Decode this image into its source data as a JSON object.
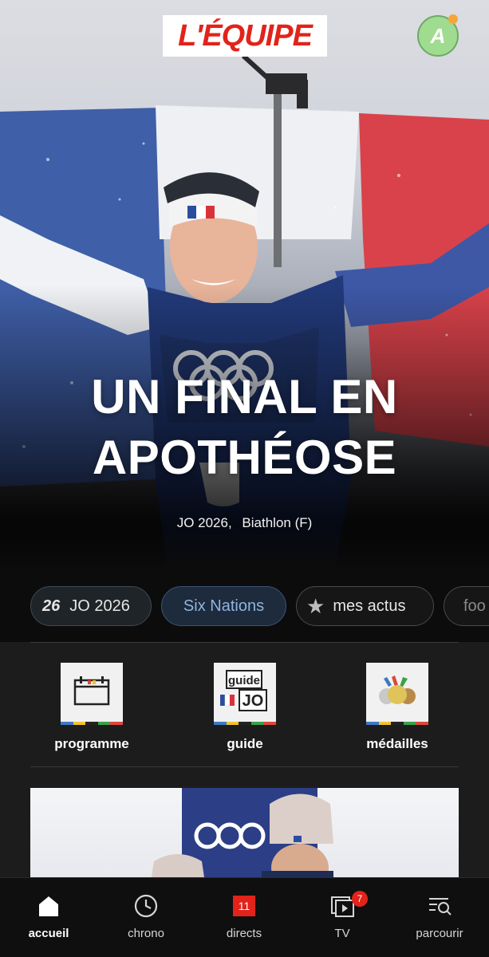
{
  "header": {
    "logo_text": "L'ÉQUIPE",
    "avatar_initial": "A"
  },
  "hero": {
    "headline_line1": "UN FINAL EN",
    "headline_line2": "APOTHÉOSE",
    "tags": [
      "JO 2026,",
      "Biathlon (F)"
    ]
  },
  "chips": [
    {
      "label": "JO 2026",
      "icon": "jo-2026-icon"
    },
    {
      "label": "Six Nations",
      "selected": true
    },
    {
      "label": "mes actus",
      "icon": "star-icon"
    },
    {
      "label": "foo"
    }
  ],
  "quick_links": [
    {
      "label": "programme",
      "icon": "calendar-icon"
    },
    {
      "label": "guide",
      "icon": "guide-jo-icon",
      "icon_text_top": "guide",
      "icon_text_bottom": "JO"
    },
    {
      "label": "médailles",
      "icon": "medals-icon"
    }
  ],
  "bottom_nav": [
    {
      "label": "accueil",
      "icon": "home-icon",
      "active": true
    },
    {
      "label": "chrono",
      "icon": "clock-icon"
    },
    {
      "label": "directs",
      "icon": "live-icon",
      "badge": "11"
    },
    {
      "label": "TV",
      "icon": "tv-icon",
      "badge": "7"
    },
    {
      "label": "parcourir",
      "icon": "browse-icon"
    }
  ],
  "colors": {
    "brand_red": "#e2231a",
    "background": "#1c1c1c",
    "chip_selected_bg": "#1d2b3c",
    "chip_selected_text": "#8fb4df",
    "avatar_green": "#9fdc8f",
    "avatar_dot": "#f4a63a"
  }
}
